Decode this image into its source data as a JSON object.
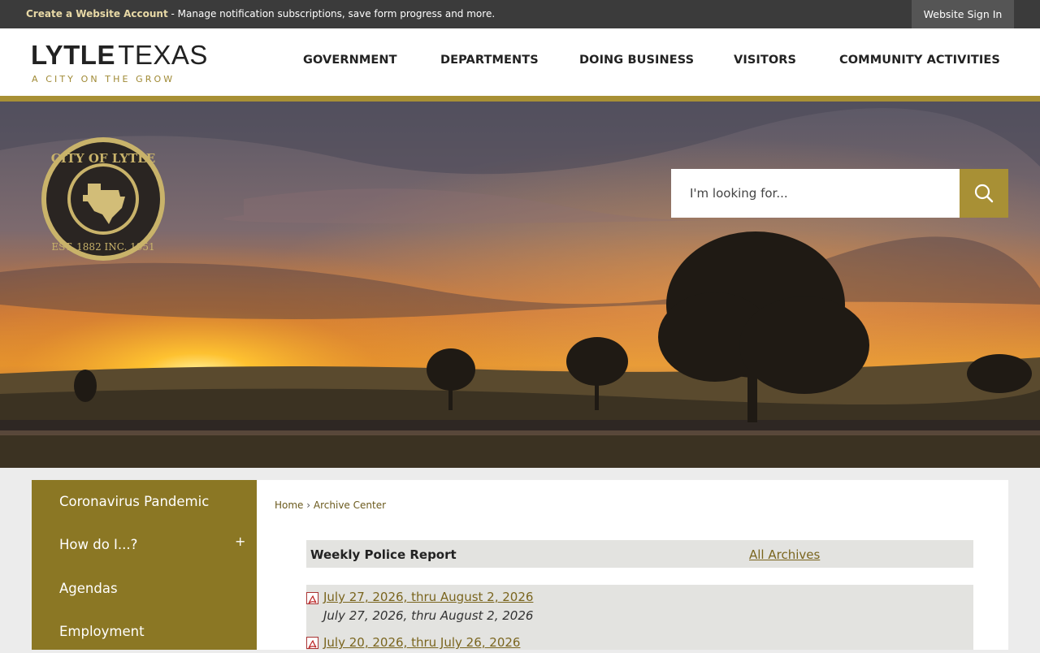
{
  "topbar": {
    "create_account_link": "Create a Website Account",
    "create_account_text": " - Manage notification subscriptions, save form progress and more.",
    "signin_label": "Website Sign In"
  },
  "logo": {
    "name_bold": "LYTLE",
    "name_light": "TEXAS",
    "tagline": "A CITY ON THE GROW"
  },
  "nav": {
    "items": [
      "GOVERNMENT",
      "DEPARTMENTS",
      "DOING BUSINESS",
      "VISITORS",
      "COMMUNITY ACTIVITIES"
    ]
  },
  "seal": {
    "top_text": "CITY OF LYTLE",
    "bottom_text": "EST. 1882 INC. 1951"
  },
  "search": {
    "placeholder": "I'm looking for...",
    "icon": "search-icon"
  },
  "sidebar": {
    "items": [
      "Coronavirus Pandemic",
      "How do I...?",
      "Agendas",
      "Employment"
    ],
    "expand_symbol": "+"
  },
  "breadcrumb": {
    "home": "Home",
    "separator": "›",
    "current": "Archive Center"
  },
  "archive": {
    "title": "Weekly Police Report",
    "all_link": "All Archives",
    "items": [
      {
        "link": "July 27, 2026, thru August 2, 2026",
        "desc": "July 27, 2026, thru August 2, 2026",
        "icon": "pdf-icon"
      },
      {
        "link": "July 20, 2026, thru July 26, 2026",
        "icon": "pdf-icon"
      }
    ]
  },
  "colors": {
    "gold": "#a89035",
    "sidebar": "#8b7724",
    "topbar": "#3b3b3b"
  }
}
